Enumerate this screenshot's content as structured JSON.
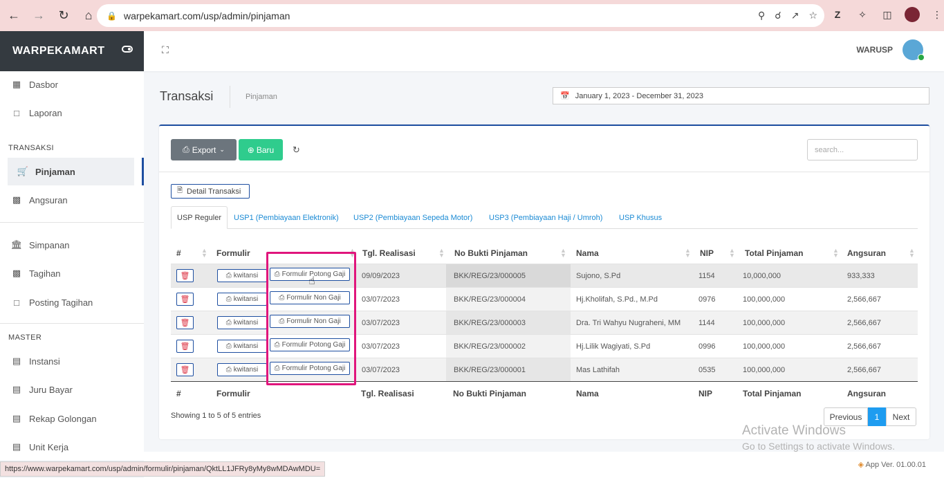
{
  "browser": {
    "url": "warpekamart.com/usp/admin/pinjaman",
    "status_url": "https://www.warpekamart.com/usp/admin/formulir/pinjaman/QktLL1JFRy8yMy8wMDAwMDU="
  },
  "sidebar": {
    "brand": "WARPEKAMART",
    "items": [
      {
        "label": "Dasbor",
        "icon": "dashboard-icon"
      },
      {
        "label": "Laporan",
        "icon": "document-icon"
      }
    ],
    "sections": [
      {
        "header": "TRANSAKSI",
        "items": [
          {
            "label": "Pinjaman",
            "icon": "cart-icon",
            "active": true
          },
          {
            "label": "Angsuran",
            "icon": "money-icon"
          }
        ]
      },
      {
        "header": "",
        "items": [
          {
            "label": "Simpanan",
            "icon": "bank-icon"
          },
          {
            "label": "Tagihan",
            "icon": "money-icon"
          },
          {
            "label": "Posting Tagihan",
            "icon": "document-icon"
          }
        ]
      },
      {
        "header": "MASTER",
        "items": [
          {
            "label": "Instansi",
            "icon": "book-icon"
          },
          {
            "label": "Juru Bayar",
            "icon": "book-icon"
          },
          {
            "label": "Rekap Golongan",
            "icon": "book-icon"
          },
          {
            "label": "Unit Kerja",
            "icon": "book-icon"
          }
        ]
      }
    ]
  },
  "topbar": {
    "user_name": "WARUSP"
  },
  "page": {
    "title": "Transaksi",
    "breadcrumb": "Pinjaman",
    "date_range": "January 1, 2023 - December 31, 2023"
  },
  "toolbar": {
    "export_label": "Export",
    "new_label": "Baru",
    "search_placeholder": "search..."
  },
  "detail_button": "Detail Transaksi",
  "tabs": [
    {
      "label": "USP Reguler",
      "active": true
    },
    {
      "label": "USP1 (Pembiayaan Elektronik)"
    },
    {
      "label": "USP2 (Pembiayaan Sepeda Motor)"
    },
    {
      "label": "USP3 (Pembiayaan Haji / Umroh)"
    },
    {
      "label": "USP Khusus"
    }
  ],
  "table": {
    "columns": [
      "#",
      "Formulir",
      "Tgl. Realisasi",
      "No Bukti Pinjaman",
      "Nama",
      "NIP",
      "Total Pinjaman",
      "Angsuran"
    ],
    "kwitansi_label": "kwitansi",
    "rows": [
      {
        "form": "Formulir Potong Gaji",
        "date": "09/09/2023",
        "no": "BKK/REG/23/000005",
        "name": "Sujono, S.Pd",
        "nip": "1154",
        "total": "10,000,000",
        "angsuran": "933,333"
      },
      {
        "form": "Formulir Non Gaji",
        "date": "03/07/2023",
        "no": "BKK/REG/23/000004",
        "name": "Hj.Kholifah, S.Pd., M.Pd",
        "nip": "0976",
        "total": "100,000,000",
        "angsuran": "2,566,667"
      },
      {
        "form": "Formulir Non Gaji",
        "date": "03/07/2023",
        "no": "BKK/REG/23/000003",
        "name": "Dra. Tri Wahyu Nugraheni, MM",
        "nip": "1144",
        "total": "100,000,000",
        "angsuran": "2,566,667"
      },
      {
        "form": "Formulir Potong Gaji",
        "date": "03/07/2023",
        "no": "BKK/REG/23/000002",
        "name": "Hj.Lilik Wagiyati, S.Pd",
        "nip": "0996",
        "total": "100,000,000",
        "angsuran": "2,566,667"
      },
      {
        "form": "Formulir Potong Gaji",
        "date": "03/07/2023",
        "no": "BKK/REG/23/000001",
        "name": "Mas Lathifah",
        "nip": "0535",
        "total": "100,000,000",
        "angsuran": "2,566,667"
      }
    ]
  },
  "pagination": {
    "info": "Showing 1 to 5 of 5 entries",
    "prev": "Previous",
    "current": "1",
    "next": "Next"
  },
  "watermark": {
    "line1": "Activate Windows",
    "line2": "Go to Settings to activate Windows."
  },
  "footer": {
    "app_version": "App Ver. 01.00.01"
  }
}
